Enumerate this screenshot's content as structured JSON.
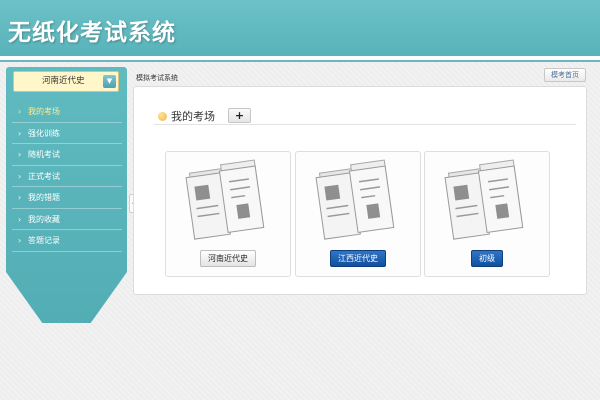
{
  "header": {
    "title": "无纸化考试系统"
  },
  "sidebar": {
    "course_selector": "河南近代史",
    "items": [
      {
        "label": "我的考场",
        "active": true
      },
      {
        "label": "强化训练",
        "active": false
      },
      {
        "label": "随机考试",
        "active": false
      },
      {
        "label": "正式考试",
        "active": false
      },
      {
        "label": "我的错题",
        "active": false
      },
      {
        "label": "我的收藏",
        "active": false
      },
      {
        "label": "答题记录",
        "active": false
      }
    ]
  },
  "main": {
    "breadcrumb": "模拟考试系统",
    "home_button": "模考首页",
    "section_title": "我的考场",
    "add_button": "+",
    "cards": [
      {
        "label": "河南近代史",
        "style": "grey"
      },
      {
        "label": "江西近代史",
        "style": "blue"
      },
      {
        "label": "初级",
        "style": "blue"
      }
    ]
  },
  "colors": {
    "header_teal": "#5db7be",
    "selected_item": "#ffec8a",
    "button_blue": "#1a5aab",
    "course_select_bg": "#fff7c9"
  },
  "icons": {
    "collapse": "chevron-left-icon",
    "dropdown": "chevron-down-icon",
    "section": "orange-dot-icon",
    "card": "exam-paper-icon"
  }
}
